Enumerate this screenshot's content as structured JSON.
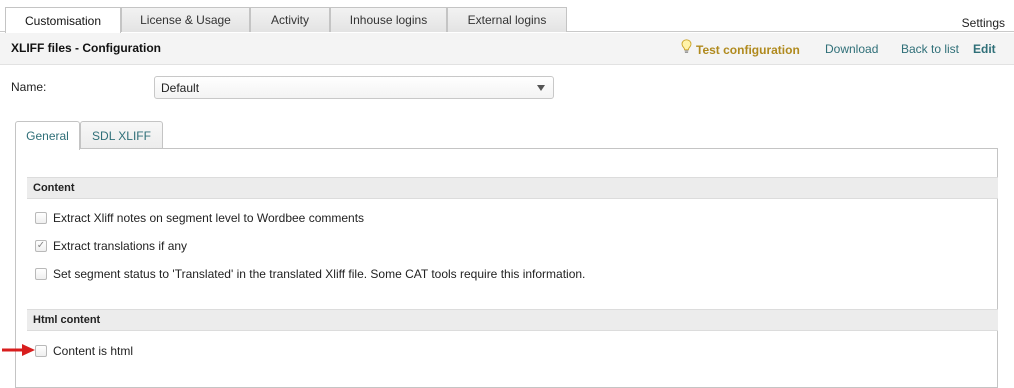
{
  "top_tabs": [
    {
      "label": "Customisation",
      "active": true
    },
    {
      "label": "License & Usage",
      "active": false
    },
    {
      "label": "Activity",
      "active": false
    },
    {
      "label": "Inhouse logins",
      "active": false
    },
    {
      "label": "External logins",
      "active": false
    }
  ],
  "settings_label": "Settings",
  "page_title": "XLIFF files - Configuration",
  "toolbar": {
    "test_label": "Test configuration",
    "download_label": "Download",
    "back_label": "Back to list",
    "edit_label": "Edit"
  },
  "name_field": {
    "label": "Name:",
    "value": "Default"
  },
  "inner_tabs": [
    {
      "label": "General",
      "active": true
    },
    {
      "label": "SDL XLIFF",
      "active": false
    }
  ],
  "sections": {
    "content": {
      "title": "Content",
      "options": [
        {
          "label": "Extract Xliff notes on segment level to Wordbee comments",
          "checked": false
        },
        {
          "label": "Extract translations if any",
          "checked": true
        },
        {
          "label": "Set segment status to 'Translated' in the translated Xliff file. Some CAT tools require this information.",
          "checked": false
        }
      ]
    },
    "html": {
      "title": "Html content",
      "options": [
        {
          "label": "Content is html",
          "checked": false
        }
      ]
    }
  },
  "colors": {
    "accent_link": "#2f6f78",
    "test_link": "#b08a1e",
    "annotation_arrow": "#d81e1e"
  }
}
